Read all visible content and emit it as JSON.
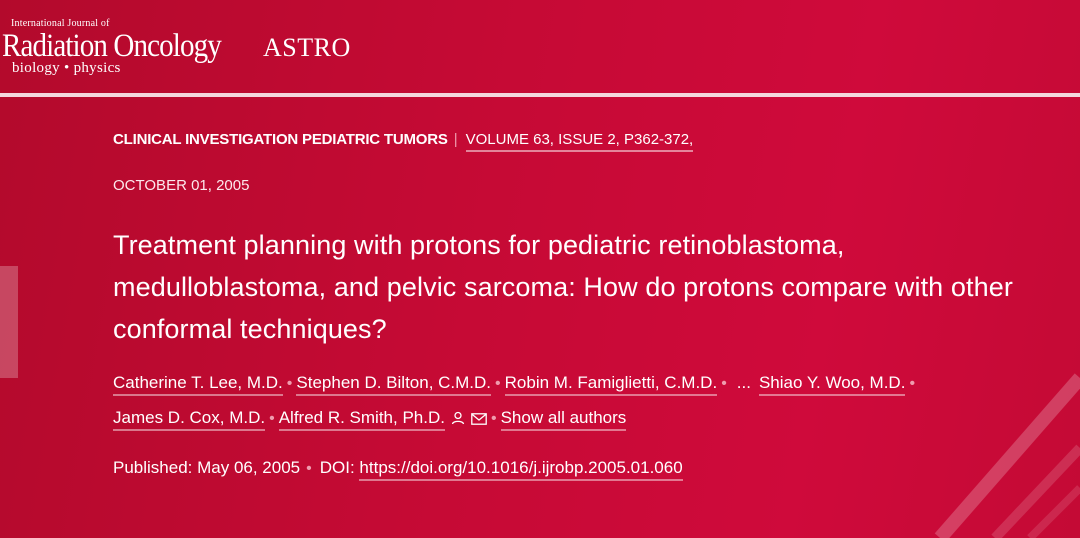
{
  "header": {
    "journal_prefix": "International Journal of",
    "journal_name": "Radiation Oncology",
    "journal_subtitle": "biology • physics",
    "society": "ASTRO"
  },
  "article": {
    "section": "CLINICAL INVESTIGATION PEDIATRIC TUMORS",
    "separator": "|",
    "volume_issue": "VOLUME 63, ISSUE 2, P362-372,",
    "date": "OCTOBER 01, 2005",
    "title": "Treatment planning with protons for pediatric retinoblastoma, medulloblastoma, and pelvic sarcoma: How do protons compare with other conformal techniques?",
    "authors": [
      "Catherine T. Lee, M.D.",
      "Stephen D. Bilton, C.M.D.",
      "Robin M. Famiglietti, C.M.D.",
      "Shiao Y. Woo, M.D.",
      "James D. Cox, M.D.",
      "Alfred R. Smith, Ph.D."
    ],
    "ellipsis": "...",
    "show_all_authors": "Show all authors",
    "published_label": "Published: May 06, 2005",
    "doi_label": "DOI:",
    "doi_url": "https://doi.org/10.1016/j.ijrobp.2005.01.060"
  },
  "colors": {
    "background": "#c60a35",
    "separator_dot": "#ef9cae",
    "header_divider": "#f4d8de"
  },
  "icons": [
    "person-icon",
    "mail-icon"
  ]
}
